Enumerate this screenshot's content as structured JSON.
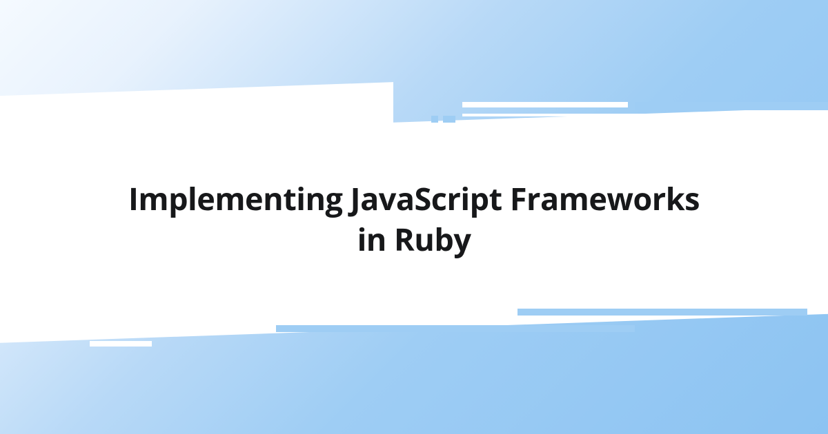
{
  "title": {
    "line1": "Implementing JavaScript Frameworks",
    "line2": "in Ruby"
  },
  "colors": {
    "accent": "#9ecdf4",
    "text": "#17181a",
    "background_white": "#ffffff"
  }
}
